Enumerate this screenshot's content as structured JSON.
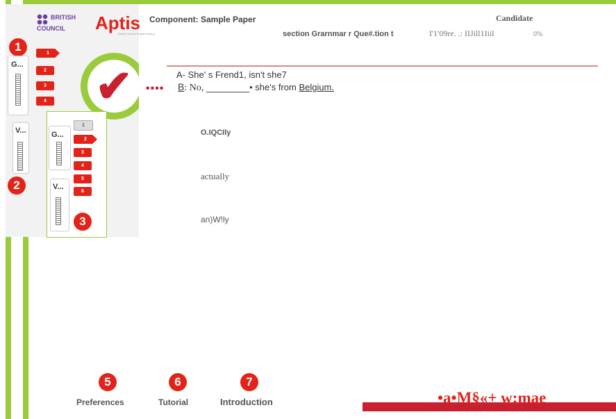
{
  "header": {
    "component": "Component: Sample Paper",
    "candidate": "Candidate",
    "section": "section Grarnmar r Que#.tion t",
    "progress": "I'1'09re. .: IIJill1Iiil",
    "percent": "0%"
  },
  "logos": {
    "british_council": "BRITISH COUNCIL",
    "aptis": "Aptis",
    "aptis_sub": "British Council English testing"
  },
  "sidebar": {
    "callouts": [
      "1",
      "2",
      "3"
    ],
    "section_g": "G...",
    "section_v": "V...",
    "question_buttons": [
      "1",
      "2",
      "3",
      "4"
    ],
    "inset_question_buttons": [
      "1",
      "2",
      "3",
      "4",
      "5",
      "6"
    ],
    "inset_section_g": "G...",
    "inset_section_v": "V..."
  },
  "question": {
    "line_a": "A- She' s Frend1, isn't she7",
    "line_b_speaker": "B",
    "line_b_start": ": No, ",
    "blank": "________",
    "line_b_mid": "• she's from ",
    "line_b_end": "Belgium.",
    "options": [
      "O.IQCIly",
      "actually",
      "an)W!ly"
    ]
  },
  "footer": {
    "callouts": [
      "5",
      "6",
      "7"
    ],
    "preferences": "Preferences",
    "tutorial": "Tutorial",
    "introduction": "Introduction",
    "logo_text": "•a•M§«+ w:mae"
  },
  "colors": {
    "accent_green": "#9acb3c",
    "accent_red": "#e2231a"
  }
}
